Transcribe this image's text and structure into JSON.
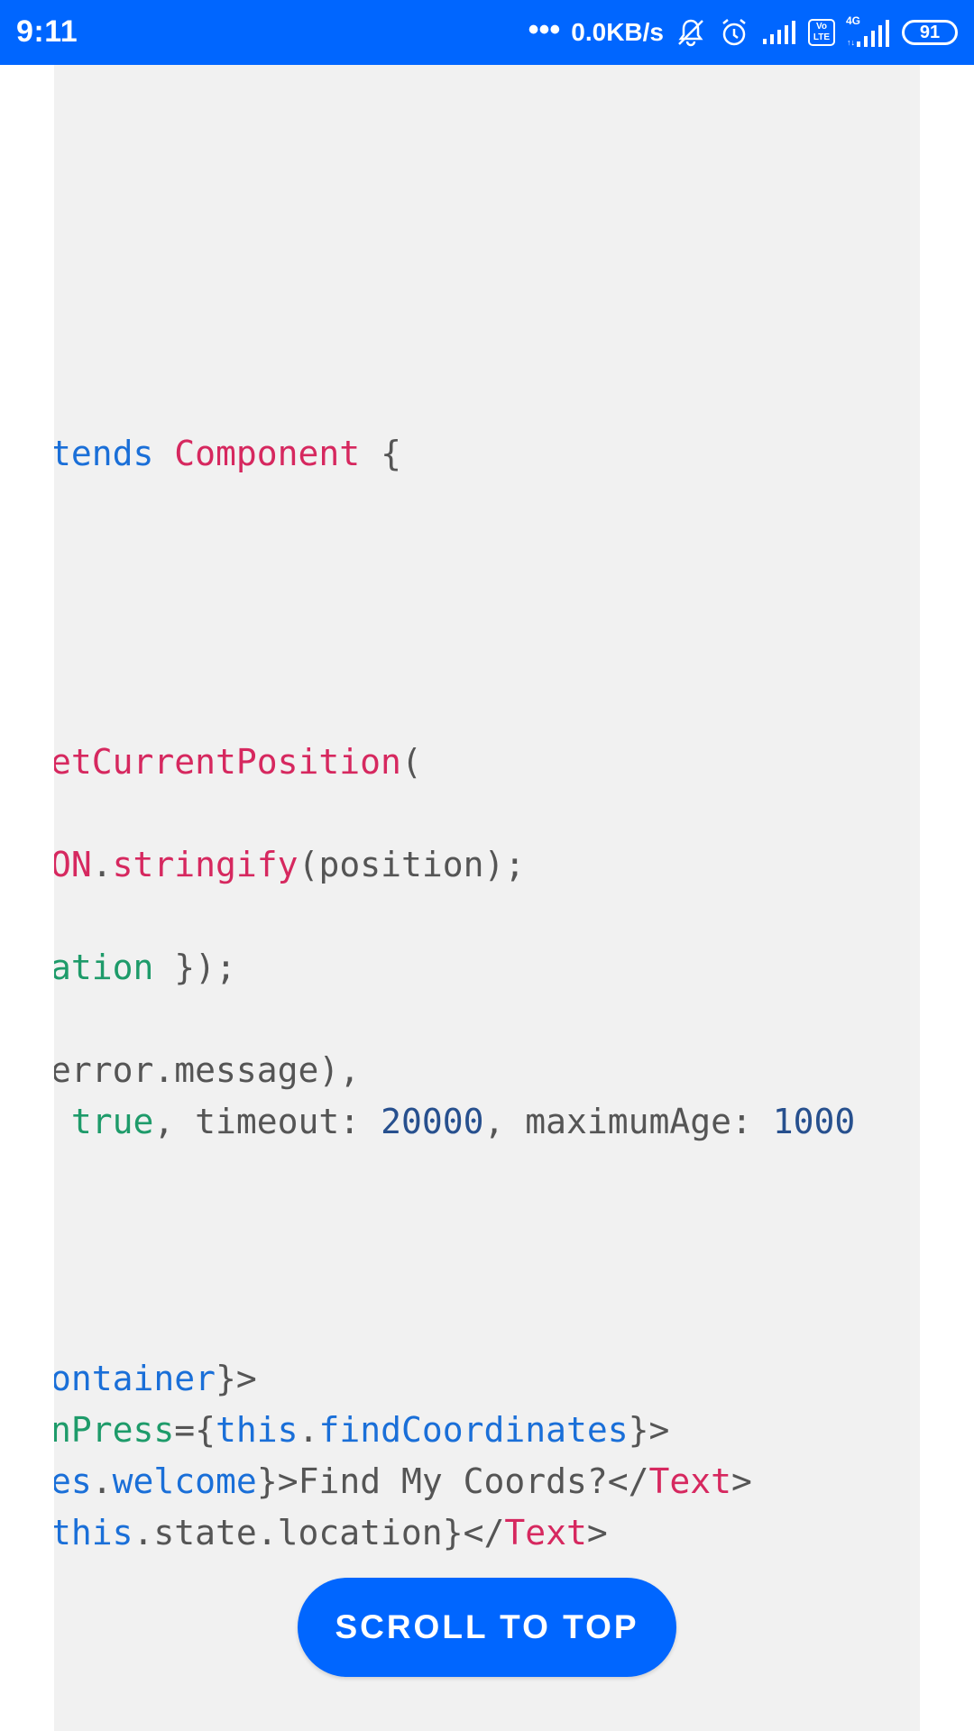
{
  "status_bar": {
    "time": "9:11",
    "dots": "•••",
    "net_speed": "0.0KB/s",
    "icons": [
      "bell-muted-icon",
      "alarm-icon",
      "signal-icon",
      "volte-icon",
      "signal-4g-icon"
    ],
    "volte_label_top": "Vo",
    "volte_label_bottom": "LTE",
    "network_label": "4G",
    "battery": "91",
    "background_color": "#0066ff"
  },
  "code": {
    "lines": {
      "l1": {
        "a": "tends ",
        "b": "Component",
        "c": " {"
      },
      "l2": {
        "a": "etCurrentPosition",
        "b": "("
      },
      "l3": {
        "a": "ON",
        "b": ".",
        "c": "stringify",
        "d": "(position);"
      },
      "l4": {
        "a": "ation",
        "b": " });"
      },
      "l5": {
        "a": "error.message),"
      },
      "l6": {
        "a": " ",
        "b": "true",
        "c": ", timeout: ",
        "d": "20000",
        "e": ", maximumAge: ",
        "f": "1000"
      },
      "l7": {
        "a": "ontainer",
        "b": "}>"
      },
      "l8": {
        "a": "nPress",
        "b": "={",
        "c": "this",
        "d": ".",
        "e": "findCoordinates",
        "f": "}>"
      },
      "l9": {
        "a": "es",
        "b": ".",
        "c": "welcome",
        "d": "}>Find My Coords?</",
        "e": "Text",
        "f": ">"
      },
      "l10": {
        "a": "this",
        "b": ".state.lo",
        "c": "cation}</",
        "d": "Text",
        "e": ">"
      }
    },
    "colors": {
      "keyword": "#1a6fd8",
      "function": "#d6285f",
      "property": "#1e9b6a",
      "number": "#27508e",
      "plain": "#555555",
      "background": "#f1f1f1"
    }
  },
  "scroll_button": {
    "label": "SCROLL TO TOP",
    "color": "#0066ff"
  }
}
